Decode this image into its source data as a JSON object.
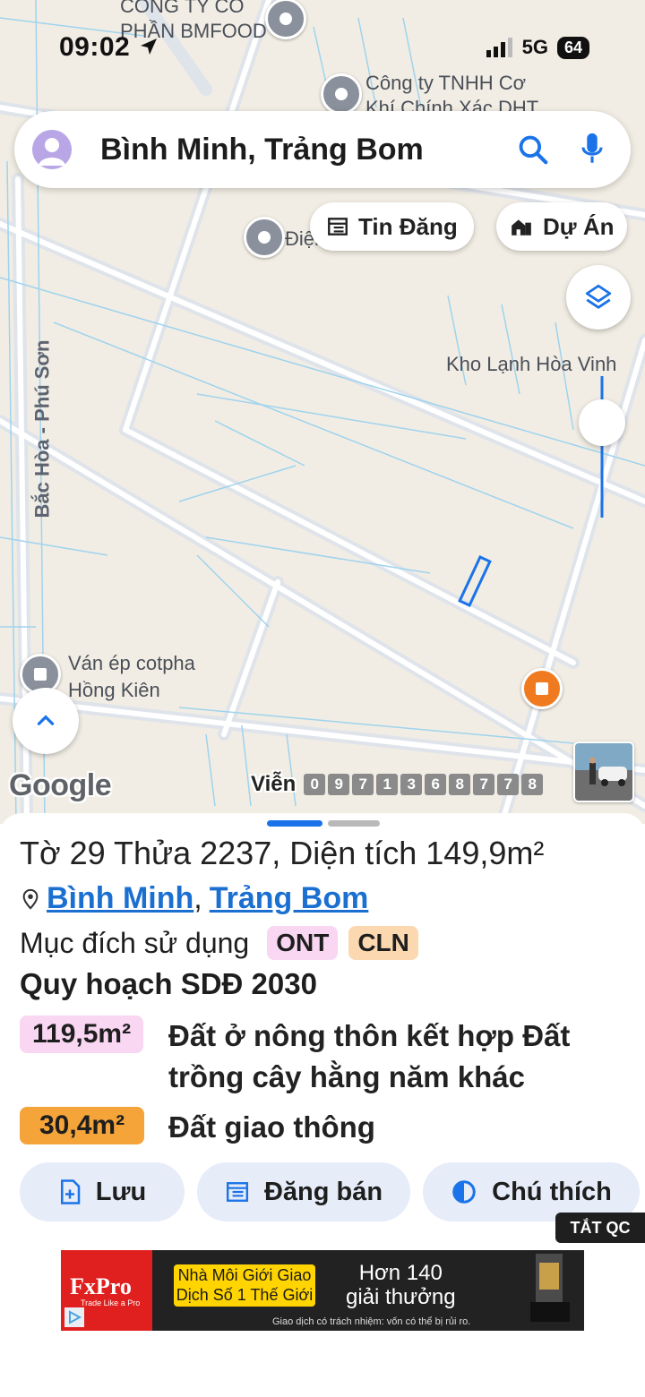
{
  "status_bar": {
    "time": "09:02",
    "network": "5G",
    "battery": "64"
  },
  "search": {
    "query": "Bình Minh, Trảng Bom"
  },
  "map": {
    "labels": {
      "company1_line1": "CÔNG TY CỔ",
      "company1_line2": "PHẦN BMFOOD",
      "company2_line1": "Công ty TNHH Cơ",
      "company2_line2": "Khí Chính Xác DHT",
      "place3": "Điện",
      "cold_storage": "Kho Lạnh Hòa Vinh",
      "road": "Bắc Hòa - Phú Sơn",
      "shop_line1": "Ván ép cotpha",
      "shop_line2": "Hồng Kiên"
    },
    "google": "Google",
    "scale": {
      "label": "Viễn",
      "digits": [
        "0",
        "9",
        "7",
        "1",
        "3",
        "6",
        "8",
        "7",
        "7",
        "8"
      ]
    }
  },
  "chips": {
    "listings": "Tin Đăng",
    "projects": "Dự Án"
  },
  "colors": {
    "accent": "#1a73e8",
    "ont": "#f9d6f2",
    "cln": "#fbd8b0",
    "area1": "#f9d6f2",
    "area2": "#f5a43a",
    "button_bg": "#e6ecf8"
  },
  "parcel": {
    "title": "Tờ 29 Thửa 2237, Diện tích 149,9m²",
    "ward": "Bình Minh",
    "separator": ",",
    "district": "Trảng Bom",
    "purpose_label": "Mục đích sử dụng",
    "purpose_codes": [
      "ONT",
      "CLN"
    ],
    "plan_title": "Quy hoạch SDĐ 2030",
    "zones": [
      {
        "area": "119,5m²",
        "desc_line1": "Đất ở nông thôn kết hợp Đất",
        "desc_line2": "trồng cây hằng năm khác"
      },
      {
        "area": "30,4m²",
        "desc_line1": "Đất giao thông"
      }
    ]
  },
  "actions": {
    "save": "Lưu",
    "post_sale": "Đăng bán",
    "legend": "Chú thích"
  },
  "ad": {
    "close_ads": "TẮT QC",
    "brand": "FxPro",
    "brand_tagline": "Trade Like a Pro",
    "line1": "Nhà Môi Giới Giao",
    "line2": "Dịch Số 1 Thế Giới",
    "award_line1": "Hơn 140",
    "award_line2": "giải thưởng",
    "disclaimer": "Giao dịch có trách nhiệm: vốn có thể bị rủi ro."
  }
}
